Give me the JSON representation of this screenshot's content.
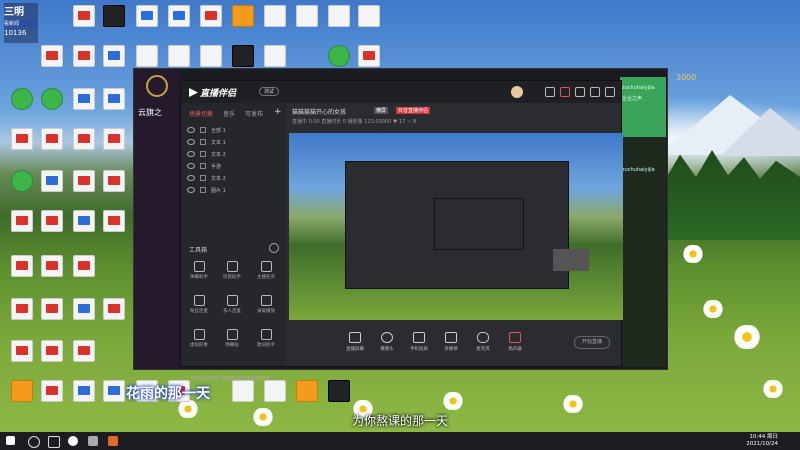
{
  "desktop": {
    "top_left": {
      "line1": "三明",
      "line2": "看新闻",
      "line3": "10136"
    },
    "caption": "为你熬课的那一天",
    "watermark": "花雨的那一天"
  },
  "background_window": {
    "title": "云旗之",
    "coins": "3000"
  },
  "right_panel": {
    "line1": "zuchuhaiyijia",
    "line2": "企业之声",
    "line3": "zuchuhaiyijia"
  },
  "app": {
    "brand": "直播伴侣",
    "version": "测试",
    "side_tabs": [
      "场景切换",
      "音乐",
      "可发布"
    ],
    "scenes": [
      "全部 1",
      "文本 1",
      "文本 2",
      "手游",
      "文本 2",
      "图片 1"
    ],
    "tools_title": "工具箱",
    "tools": [
      "弹幕助手",
      "房管助手",
      "主播任务",
      "粉丝连麦",
      "多人连麦",
      "录屏播放",
      "虚拟形象",
      "弹幕贴",
      "歌词助手"
    ],
    "tip": "如何把多开后直播面面切换和收到?",
    "room_title": "猫猫猫猫开心的女孩",
    "badge_live": "横屏",
    "badge_red": "抖音直播伴侣",
    "room_sub": "直播中 0.00  直播时长 0  播放量 123.00000  ♥ 17  ☆ 8",
    "bottom_tools": [
      "直播屏幕",
      "摄像头",
      "手机投屏",
      "多媒体",
      "麦克风",
      "扬声器"
    ],
    "start_button": "开始直播"
  },
  "taskbar": {
    "time": "10:44 周日",
    "date": "2021/10/24"
  }
}
